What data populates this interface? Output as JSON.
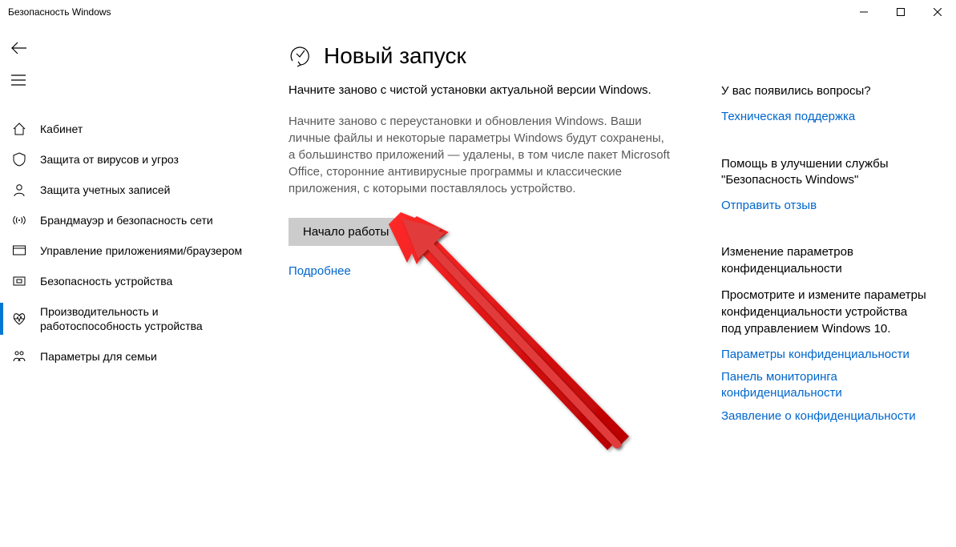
{
  "window": {
    "title": "Безопасность Windows"
  },
  "sidebar": {
    "items": [
      {
        "label": "Кабинет"
      },
      {
        "label": "Защита от вирусов и угроз"
      },
      {
        "label": "Защита учетных записей"
      },
      {
        "label": "Брандмауэр и безопасность сети"
      },
      {
        "label": "Управление приложениями/браузером"
      },
      {
        "label": "Безопасность устройства"
      },
      {
        "label": "Производительность и работоспособность устройства"
      },
      {
        "label": "Параметры для семьи"
      }
    ]
  },
  "main": {
    "title": "Новый запуск",
    "subtitle": "Начните заново с чистой установки актуальной версии Windows.",
    "description": "Начните заново с переустановки и обновления Windows. Ваши личные файлы и некоторые параметры Windows будут сохранены, а большинство приложений — удалены, в том числе пакет Microsoft Office, сторонние антивирусные программы и классические приложения, с которыми поставлялось устройство.",
    "start_button": "Начало работы",
    "learn_more": "Подробнее"
  },
  "aside": {
    "questions": {
      "title": "У вас появились вопросы?",
      "link": "Техническая поддержка"
    },
    "feedback": {
      "title": "Помощь в улучшении службы \"Безопасность Windows\"",
      "link": "Отправить отзыв"
    },
    "privacy": {
      "title": "Изменение параметров конфиденциальности",
      "text": "Просмотрите и измените параметры конфиденциальности устройства под управлением Windows 10.",
      "link1": "Параметры конфиденциальности",
      "link2": "Панель мониторинга конфиденциальности",
      "link3": "Заявление о конфиденциальности"
    }
  }
}
